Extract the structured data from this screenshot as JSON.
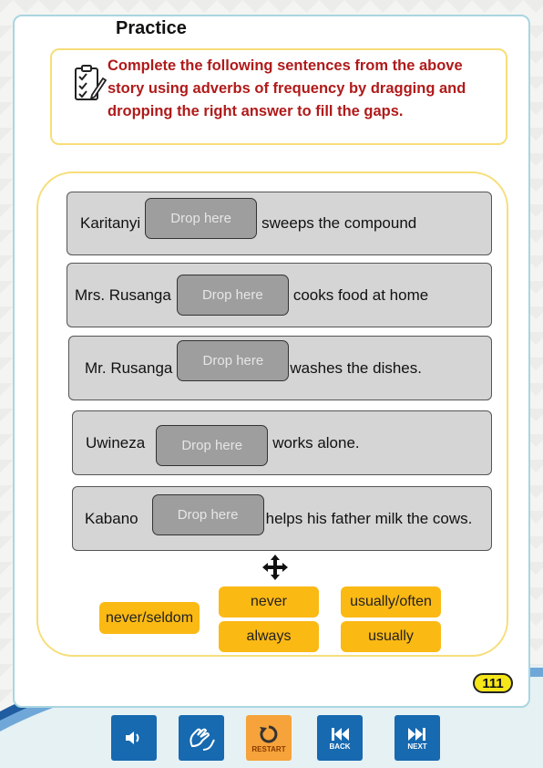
{
  "title": "Practice",
  "instructions": "Complete the following sentences from the above story using adverbs of frequency by dragging and dropping the right answer to fill the gaps.",
  "drop_placeholder": "Drop here",
  "sentences": [
    {
      "before": "Karitanyi",
      "after": "sweeps the compound"
    },
    {
      "before": "Mrs. Rusanga",
      "after": "cooks food at home"
    },
    {
      "before": "Mr. Rusanga",
      "after": "washes the dishes."
    },
    {
      "before": "Uwineza",
      "after": "works alone."
    },
    {
      "before": "Kabano",
      "after": "helps his father milk the cows."
    }
  ],
  "answers": [
    "never/seldom",
    "never",
    "always",
    "usually/often",
    "usually"
  ],
  "page_number": "111",
  "nav": {
    "restart_label": "RESTART",
    "back_label": "BACK",
    "next_label": "NEXT"
  },
  "icons": {
    "instructions": "clipboard-checklist-icon",
    "move": "move-arrows-icon",
    "audio": "speaker-icon",
    "sign_language": "sign-language-icon",
    "restart": "restart-icon",
    "back": "skip-back-icon",
    "next": "skip-next-icon"
  },
  "colors": {
    "instruction_text": "#b01a1a",
    "answer_chip": "#fbb914",
    "nav_button": "#1769b0",
    "restart_button": "#f5a33a",
    "page_badge": "#f5e61a"
  }
}
